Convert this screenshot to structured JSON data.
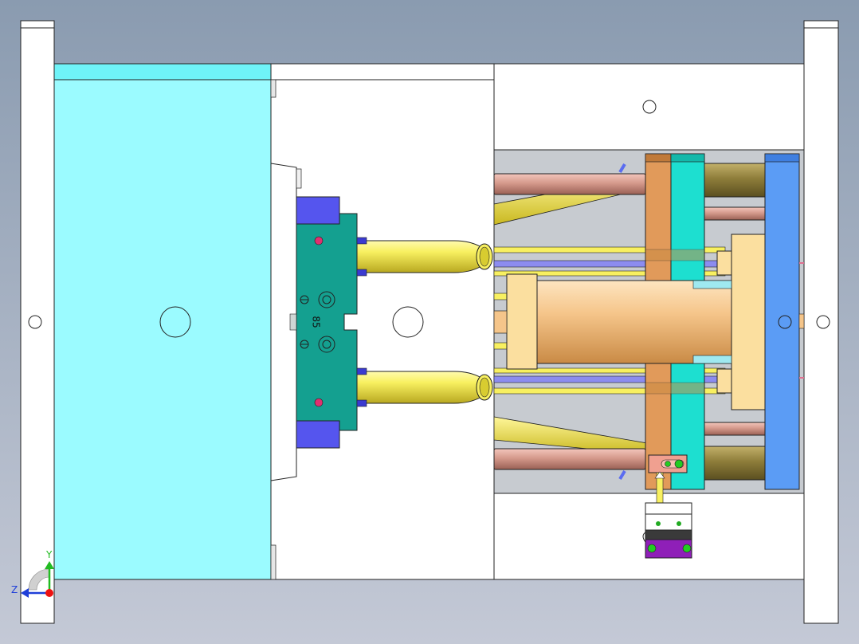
{
  "viewport": {
    "background_top": "#8a9bb0",
    "background_bottom": "#c4c9d6"
  },
  "plate_label": "85",
  "axis_triad": {
    "y_label": "Y",
    "z_label": "Z",
    "y_color": "#22bb22",
    "z_color": "#1f3fd8",
    "x_color": "#ee1111"
  },
  "colors": {
    "cavity_plate": "#9bfbff",
    "cavity_plate_top": "#6ff3f8",
    "tie_plate": "#ffffff",
    "block_teal": "#14a090",
    "block_blue": "#5555ee",
    "insert_rod": "#f8f060",
    "pin_copper": "#d59a8c",
    "ejector_plate_orange": "#e19a5a",
    "ejector_plate_cyan": "#1ddfd0",
    "clamp_plate_blue": "#5b9cf5",
    "spacer_olive": "#8e7d3a",
    "cylinder_tan": "#f5c58a",
    "pad_peach": "#fbdf9f",
    "accessory_purple": "#8f1fb8",
    "accessory_pink": "#f0a090"
  }
}
